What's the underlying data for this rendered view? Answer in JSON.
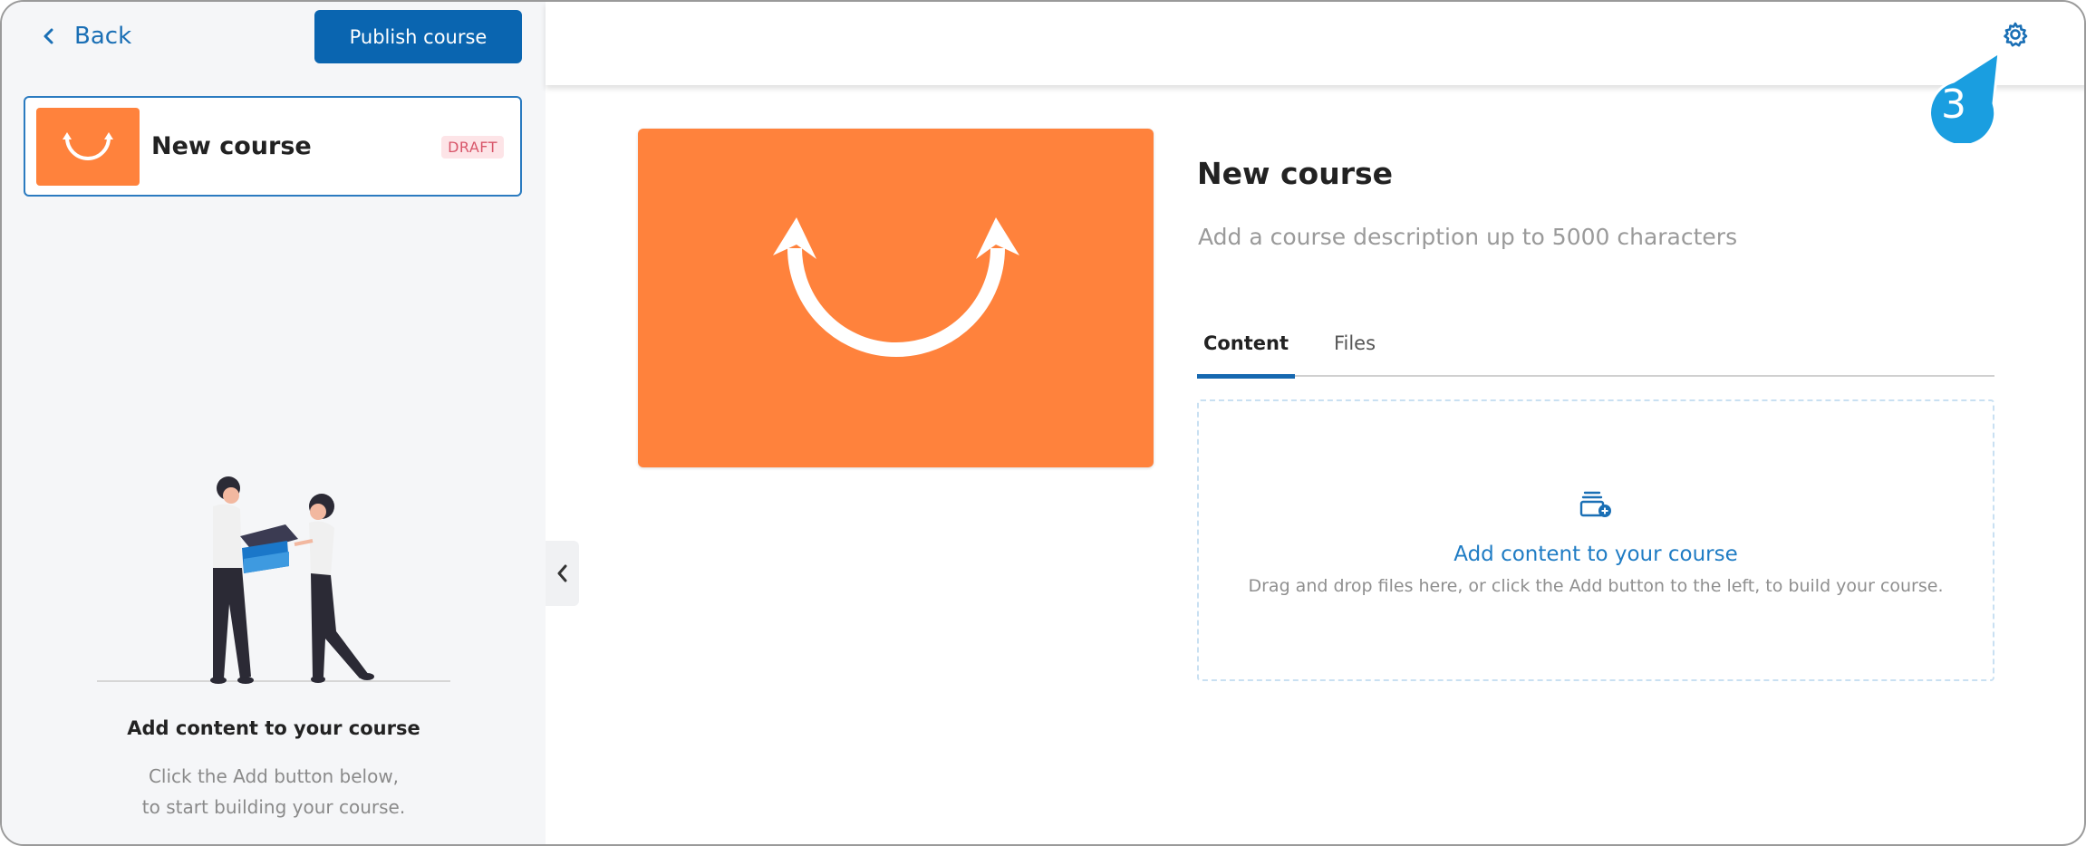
{
  "sidebar": {
    "back_label": "Back",
    "publish_label": "Publish course",
    "course_card": {
      "title": "New course",
      "badge": "DRAFT"
    },
    "empty_state": {
      "title": "Add content to your course",
      "desc_line1": "Click the Add button below,",
      "desc_line2": "to start building your course."
    }
  },
  "topbar": {
    "settings_icon": "gear-icon",
    "step_marker": "3"
  },
  "main": {
    "title": "New course",
    "description_placeholder": "Add a course description up to 5000 characters",
    "tabs": [
      {
        "label": "Content",
        "active": true
      },
      {
        "label": "Files",
        "active": false
      }
    ],
    "dropzone": {
      "icon": "add-content-icon",
      "title": "Add content to your course",
      "desc": "Drag and drop files here, or click the Add button to the left, to build your course."
    }
  },
  "colors": {
    "accent": "#0a65b0",
    "thumbnail": "#ff823c",
    "draft_badge_bg": "#fde4e7",
    "draft_badge_text": "#d8566a",
    "step_marker": "#1a9ee0"
  }
}
